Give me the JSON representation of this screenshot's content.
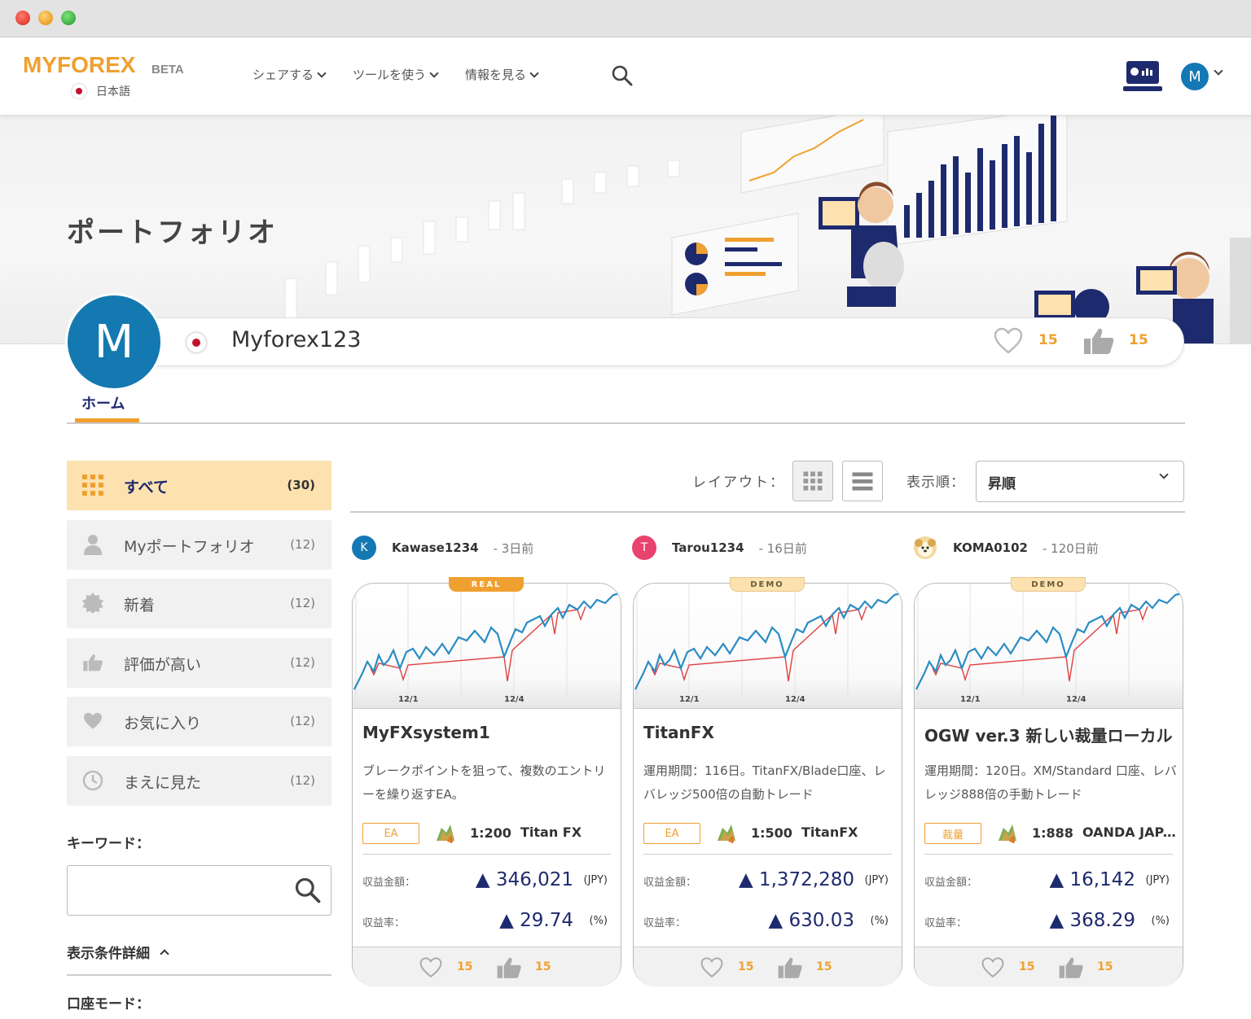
{
  "header": {
    "logo_my": "MY",
    "logo_forex": "FOREX",
    "logo_beta": "BETA",
    "language": "日本語",
    "nav": [
      {
        "label": "シェアする"
      },
      {
        "label": "ツールを使う"
      },
      {
        "label": "情報を見る"
      }
    ],
    "user_initial": "M",
    "accent_color": "#f0a030",
    "brand_blue": "#1478b4"
  },
  "hero": {
    "title": "ポートフォリオ"
  },
  "profile": {
    "initial": "M",
    "username": "Myforex123",
    "likes": "15",
    "thumbs": "15"
  },
  "tabs": [
    {
      "label": "ホーム",
      "active": true
    }
  ],
  "sidebar": {
    "items": [
      {
        "label": "すべて",
        "count": "(30)",
        "icon": "grid-icon",
        "active": true
      },
      {
        "label": "Myポートフォリオ",
        "count": "(12)",
        "icon": "person-icon"
      },
      {
        "label": "新着",
        "count": "(12)",
        "icon": "new-badge-icon"
      },
      {
        "label": "評価が高い",
        "count": "(12)",
        "icon": "thumbs-up-icon"
      },
      {
        "label": "お気に入り",
        "count": "(12)",
        "icon": "heart-icon"
      },
      {
        "label": "まえに見た",
        "count": "(12)",
        "icon": "clock-icon"
      }
    ],
    "keyword_label": "キーワード：",
    "keyword_value": "",
    "detail_label": "表示条件詳細",
    "mode_label": "口座モード："
  },
  "toolbar": {
    "layout_label": "レイアウト：",
    "sort_label": "表示順：",
    "sort_value": "昇順"
  },
  "cards": [
    {
      "author_initial": "K",
      "author_color": "#1478b4",
      "author": "Kawase1234",
      "time": "- 3日前",
      "badge": "REAL",
      "chart_ticks": [
        "12/1",
        "12/4"
      ],
      "title": "MyFXsystem1",
      "desc": "ブレークポイントを狙って、複数のエントリーを繰り返すEA。",
      "tag": "EA",
      "leverage": "1:200",
      "broker": "Titan FX",
      "profit_label": "収益金額：",
      "profit": "▲ 346,021",
      "profit_unit": "(JPY)",
      "rate_label": "収益率：",
      "rate": "▲ 29.74",
      "rate_unit": "(%)",
      "likes": "15",
      "thumbs": "15"
    },
    {
      "author_initial": "T",
      "author_color": "#e8436e",
      "author": "Tarou1234",
      "time": "- 16日前",
      "badge": "DEMO",
      "chart_ticks": [
        "12/1",
        "12/4"
      ],
      "title": "TitanFX",
      "desc": "運用期間：116日。TitanFX/Blade口座、レバレッジ500倍の自動トレード",
      "tag": "EA",
      "leverage": "1:500",
      "broker": "TitanFX",
      "profit_label": "収益金額：",
      "profit": "▲ 1,372,280",
      "profit_unit": "(JPY)",
      "rate_label": "収益率：",
      "rate": "▲ 630.03",
      "rate_unit": "(%)",
      "likes": "15",
      "thumbs": "15"
    },
    {
      "author_initial": "",
      "author_color": "#f3d9a0",
      "author": "KOMA0102",
      "time": "- 120日前",
      "badge": "DEMO",
      "chart_ticks": [
        "12/1",
        "12/4"
      ],
      "title": "OGW ver.3 新しい裁量ローカル",
      "desc": "運用期間：120日。XM/Standard 口座、レバレッジ888倍の手動トレード",
      "tag": "裁量",
      "leverage": "1:888",
      "broker": "OANDA JAPAN",
      "profit_label": "収益金額：",
      "profit": "▲ 16,142",
      "profit_unit": "(JPY)",
      "rate_label": "収益率：",
      "rate": "▲ 368.29",
      "rate_unit": "(%)",
      "likes": "15",
      "thumbs": "15"
    }
  ]
}
